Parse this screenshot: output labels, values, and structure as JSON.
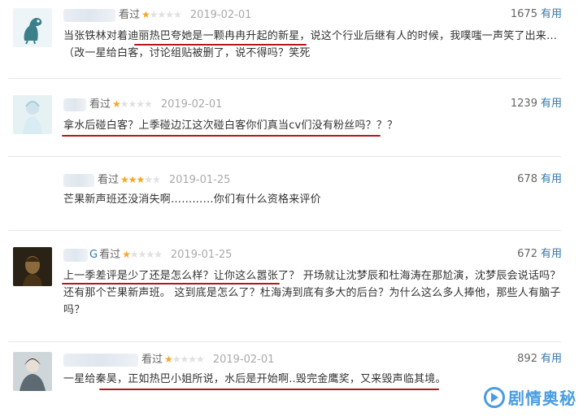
{
  "watched_label": "看过",
  "useful_label": "有用",
  "reviews": [
    {
      "name_tail": "",
      "rating": 1,
      "date": "2019-02-01",
      "votes": "1675",
      "lines": [
        "当张铁林对着迪丽热巴夸她是一颗冉冉升起的新星，说这个行业后继有人的时候，我噗嗤一声笑了出来…",
        "（改一星给白客，讨论组贴被删了，说不得吗？笑死"
      ]
    },
    {
      "name_tail": "",
      "rating": 1,
      "date": "2019-02-01",
      "votes": "1239",
      "lines": [
        "拿水后碰白客？上季碰边江这次碰白客你们真当cv们没有粉丝吗？？？"
      ]
    },
    {
      "name_tail": "",
      "rating": 3,
      "date": "2019-01-25",
      "votes": "678",
      "lines": [
        "芒果新声班还没消失啊…………你们有什么资格来评价"
      ]
    },
    {
      "name_tail": "G",
      "rating": 1,
      "date": "2019-01-25",
      "votes": "672",
      "lines": [
        "上一季差评是少了还是怎么样？让你这么嚣张了？ 开场就让沈梦辰和杜海涛在那尬演，沈梦辰会说话吗？",
        "还有那个芒果新声班。 这到底是怎么了？杜海涛到底有多大的后台？为什么这么多人捧他，那些人有脑子",
        "吗？"
      ]
    },
    {
      "name_tail": "",
      "rating": 1,
      "date": "2019-02-01",
      "votes": "892",
      "lines": [
        "一星给秦昊，正如热巴小姐所说，水后是开始啊..毁完金鹰奖，又来毁声临其境。"
      ]
    }
  ],
  "watermark": {
    "text": "剧情奥秘",
    "color": "#4a9de0"
  },
  "colors": {
    "accent_link": "#3377aa",
    "star": "#f5a623",
    "underline": "#b5151b"
  }
}
